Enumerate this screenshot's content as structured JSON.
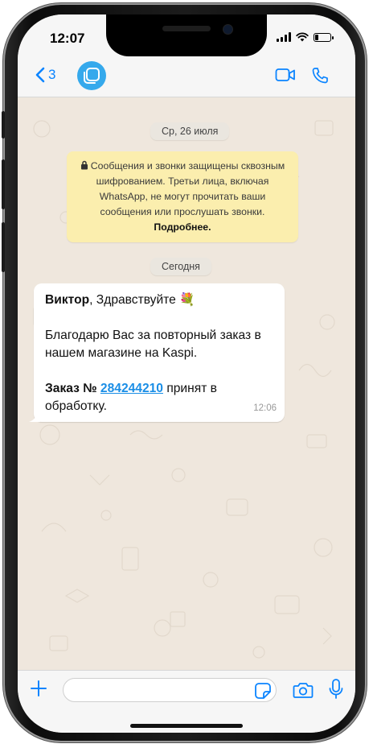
{
  "status_bar": {
    "time": "12:07",
    "icons": [
      "signal-icon",
      "wifi-icon",
      "battery-icon"
    ]
  },
  "header": {
    "back_count": "3",
    "back_icon": "chevron-left-icon",
    "avatar_icon": "square-logo-icon",
    "video_icon": "video-camera-icon",
    "call_icon": "phone-icon",
    "accent_color": "#0a84ff",
    "avatar_color": "#35a9ec"
  },
  "chat": {
    "date_1": "Ср, 26 июля",
    "encryption": {
      "icon": "lock-icon",
      "text": "Сообщения и звонки защищены сквозным шифрованием. Третьи лица, включая WhatsApp, не могут прочитать ваши сообщения или прослушать звонки.",
      "link": "Подробнее.",
      "bg_color": "#fbeeae"
    },
    "date_2": "Сегодня",
    "message": {
      "name": "Виктор",
      "greeting": ", Здравствуйте",
      "emoji": "💐",
      "body": "Благодарю Вас за повторный заказ в нашем магазине на Kaspi.",
      "order_label": "Заказ №",
      "order_number": "284244210",
      "order_status": " принят в обработку.",
      "time": "12:06",
      "link_color": "#1a8ee6"
    }
  },
  "input_bar": {
    "plus_icon": "plus-icon",
    "sticker_icon": "sticker-icon",
    "camera_icon": "camera-icon",
    "mic_icon": "microphone-icon",
    "input_value": ""
  }
}
